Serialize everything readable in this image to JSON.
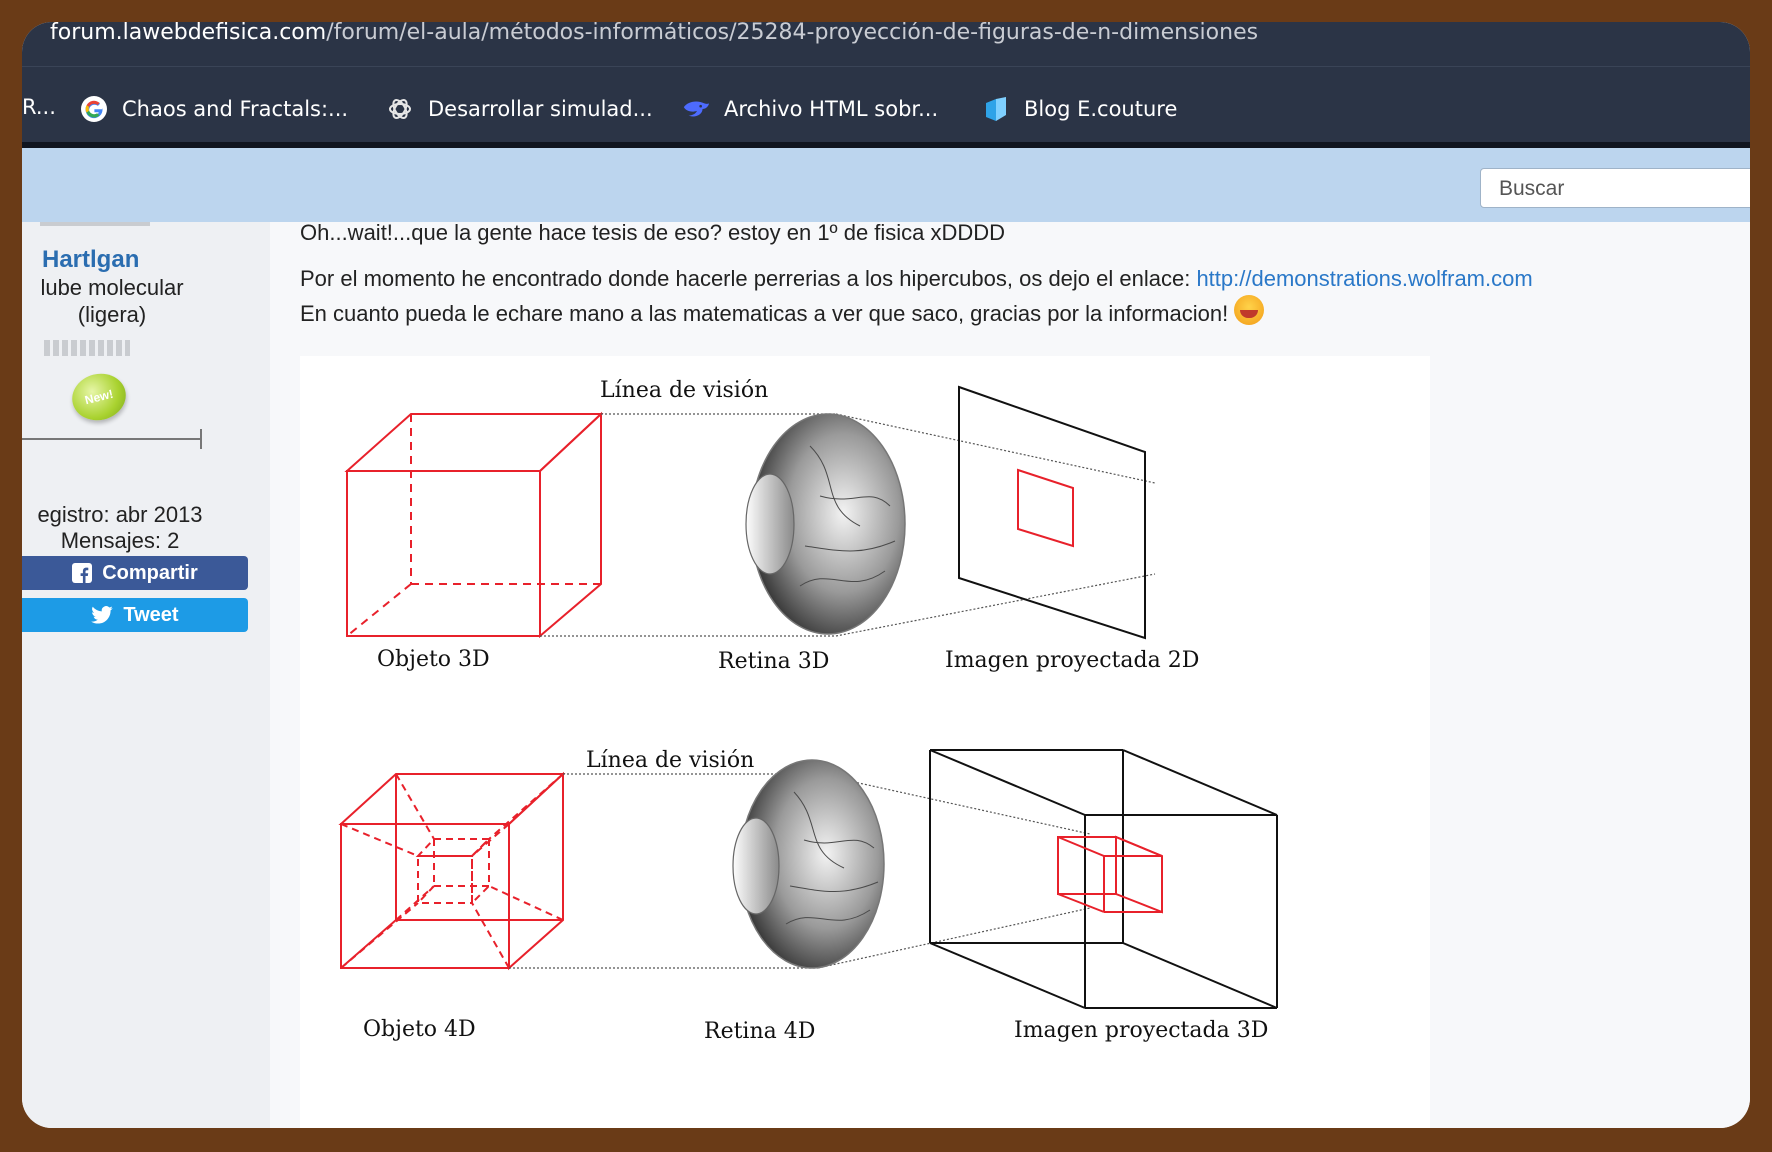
{
  "browser": {
    "url_host": "forum.lawebdefisica.com",
    "url_path": "/forum/el-aula/métodos-informáticos/25284-proyección-de-figuras-de-n-dimensiones",
    "bookmarks": [
      {
        "label": "R...",
        "icon": "bookmark-icon"
      },
      {
        "label": "Chaos and Fractals:...",
        "icon": "google-icon"
      },
      {
        "label": "Desarrollar simulad...",
        "icon": "openai-icon"
      },
      {
        "label": "Archivo HTML sobr...",
        "icon": "deepseek-icon"
      },
      {
        "label": "Blog E.couture",
        "icon": "blog-icon"
      }
    ]
  },
  "forum": {
    "search_placeholder": "Buscar"
  },
  "user": {
    "name": "Hartlgan",
    "rank_line1": "lube molecular",
    "rank_line2": "(ligera)",
    "badge": "New!",
    "registro": "egistro: abr 2013",
    "mensajes": "Mensajes: 2",
    "share_label": "Compartir",
    "tweet_label": "Tweet"
  },
  "post": {
    "line1": "Oh...wait!...que la gente hace tesis de eso? estoy en 1º de fisica xDDDD",
    "line2_text": "Por el momento he encontrado donde hacerle perrerias a los hipercubos, os dejo el enlace: ",
    "line2_link": "http://demonstrations.wolfram.com",
    "line3": "En cuanto pueda le echare mano a las matematicas a ver que saco, gracias por la informacion!"
  },
  "figure": {
    "top": {
      "sight_line": "Línea de visión",
      "object": "Objeto 3D",
      "retina": "Retina 3D",
      "image": "Imagen proyectada 2D"
    },
    "bottom": {
      "sight_line": "Línea de visión",
      "object": "Objeto 4D",
      "retina": "Retina 4D",
      "image": "Imagen proyectada 3D"
    }
  },
  "colors": {
    "link": "#2a78c8",
    "facebook": "#3b5998",
    "twitter": "#1da1f2",
    "red_wire": "#e8212b"
  }
}
